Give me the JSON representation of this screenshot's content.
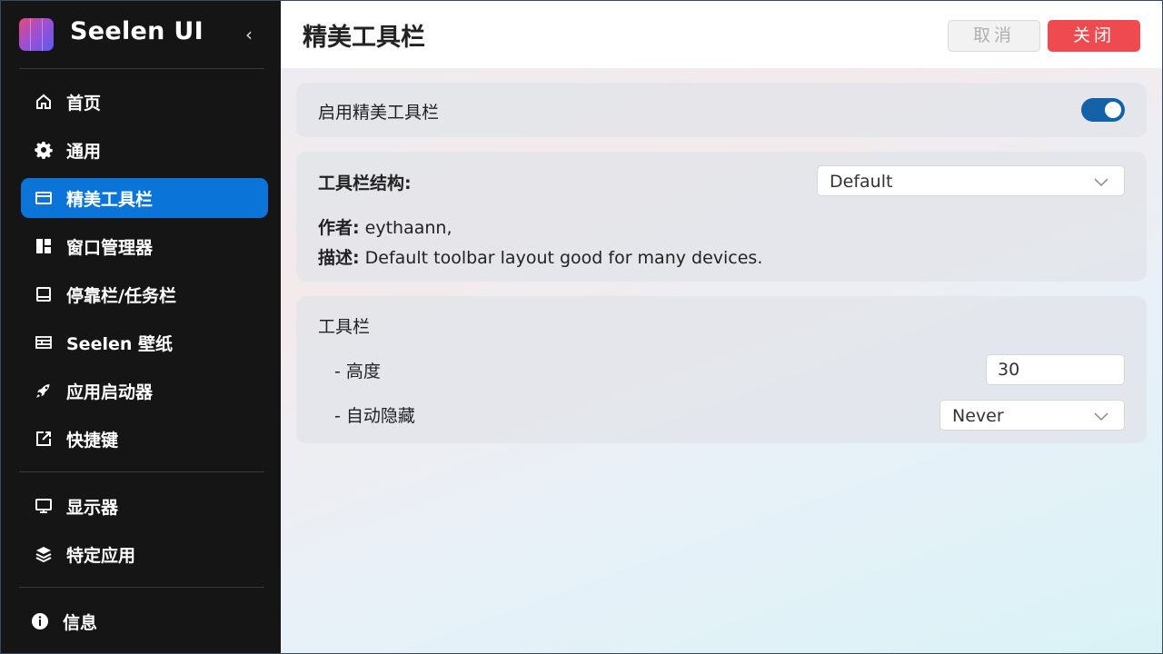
{
  "app": {
    "title": "Seelen UI",
    "collapse_glyph": "‹"
  },
  "sidebar": {
    "items": [
      {
        "label": "首页",
        "icon": "home-icon"
      },
      {
        "label": "通用",
        "icon": "gear-icon"
      },
      {
        "label": "精美工具栏",
        "icon": "window-icon",
        "active": true
      },
      {
        "label": "窗口管理器",
        "icon": "tiles-icon"
      },
      {
        "label": "停靠栏/任务栏",
        "icon": "dock-icon"
      },
      {
        "label": "Seelen 壁纸",
        "icon": "wallpaper-icon"
      },
      {
        "label": "应用启动器",
        "icon": "rocket-icon"
      },
      {
        "label": "快捷键",
        "icon": "external-link-icon"
      },
      {
        "label": "显示器",
        "icon": "monitor-icon"
      },
      {
        "label": "特定应用",
        "icon": "layers-icon"
      },
      {
        "label": "信息",
        "icon": "info-icon"
      }
    ]
  },
  "header": {
    "title": "精美工具栏",
    "cancel_label": "取消",
    "close_label": "关闭"
  },
  "enable_card": {
    "label": "启用精美工具栏",
    "enabled": true
  },
  "structure_card": {
    "label": "工具栏结构:",
    "selected": "Default",
    "author_label": "作者:",
    "author_value": "eythaann,",
    "desc_label": "描述:",
    "desc_value": "Default toolbar layout good for many devices."
  },
  "toolbar_card": {
    "title": "工具栏",
    "height_label": "- 高度",
    "height_value": "30",
    "autohide_label": "- 自动隐藏",
    "autohide_value": "Never"
  },
  "colors": {
    "accent": "#0a74d9",
    "danger": "#ef4a50",
    "toggle_on": "#1362a8",
    "sidebar_bg": "#151515"
  }
}
